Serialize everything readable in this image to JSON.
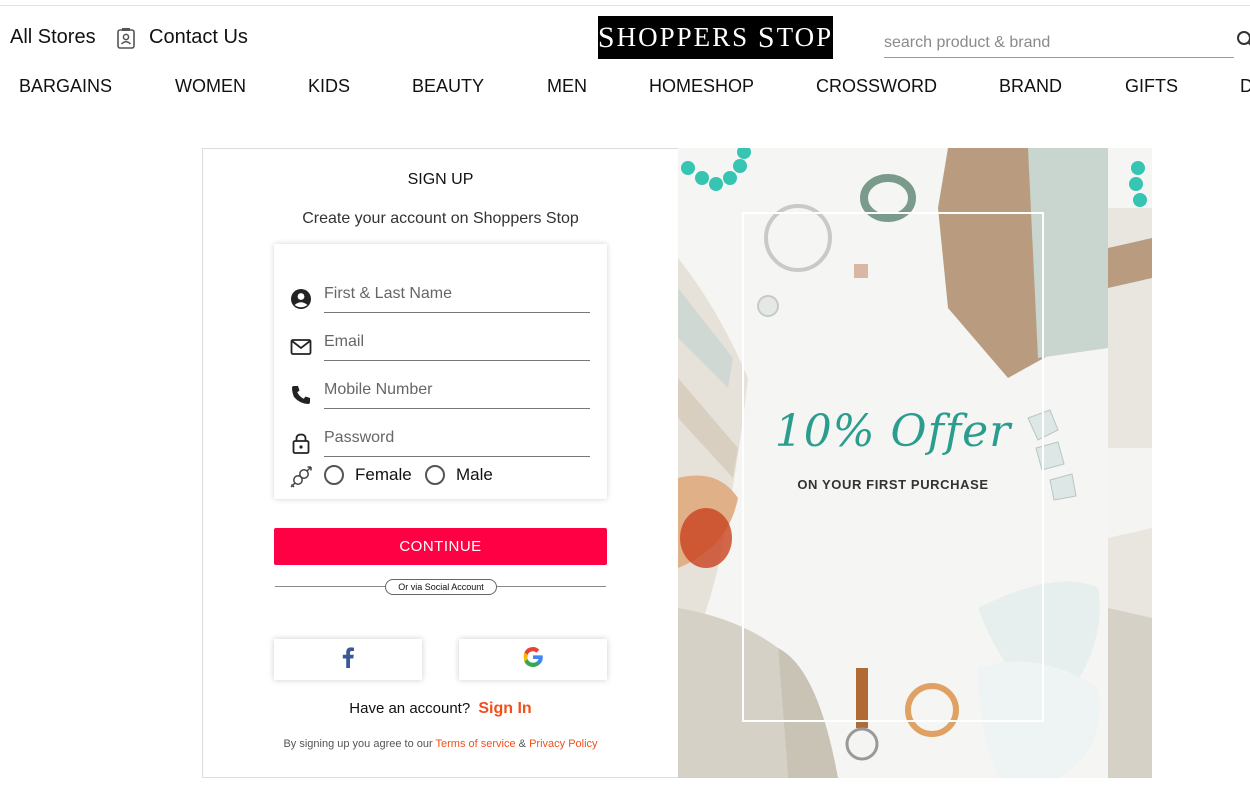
{
  "header": {
    "all_stores": "All Stores",
    "contact_us": "Contact Us",
    "contact_icon": "contact-card-icon",
    "logo_text_first_cap": "S",
    "logo_text_first_rest": "HOPPERS",
    "logo_text_second_cap": "S",
    "logo_text_second_rest": "TOP",
    "search_placeholder": "search product & brand",
    "search_icon": "search-icon"
  },
  "nav": {
    "items": [
      "BARGAINS",
      "WOMEN",
      "KIDS",
      "BEAUTY",
      "MEN",
      "HOMESHOP",
      "CROSSWORD",
      "BRAND",
      "GIFTS",
      "D"
    ]
  },
  "signup": {
    "title": "SIGN UP",
    "subtitle": "Create your account on Shoppers Stop",
    "fields": {
      "name": {
        "placeholder": "First & Last Name",
        "icon": "account-circle-icon",
        "value": ""
      },
      "email": {
        "placeholder": "Email",
        "icon": "mail-icon",
        "value": ""
      },
      "mobile": {
        "placeholder": "Mobile Number",
        "icon": "phone-icon",
        "value": ""
      },
      "password": {
        "placeholder": "Password",
        "icon": "lock-icon",
        "value": ""
      }
    },
    "gender": {
      "icon": "gender-icon",
      "options": [
        "Female",
        "Male"
      ],
      "selected": ""
    },
    "continue_label": "CONTINUE",
    "divider_label": "Or via Social Account",
    "social": {
      "facebook_icon": "facebook-icon",
      "google_icon": "google-icon"
    },
    "have_account": "Have an account?",
    "sign_in": "Sign In",
    "terms_prefix": "By signing up you agree to our",
    "terms_link": "Terms of service",
    "terms_amp": "&",
    "privacy_link": "Privacy Policy"
  },
  "promo": {
    "title": "10% Offer",
    "subtitle": "ON YOUR FIRST PURCHASE"
  },
  "colors": {
    "accent": "#ff0044",
    "link": "#f2501b",
    "offer": "#2a9d8f"
  }
}
